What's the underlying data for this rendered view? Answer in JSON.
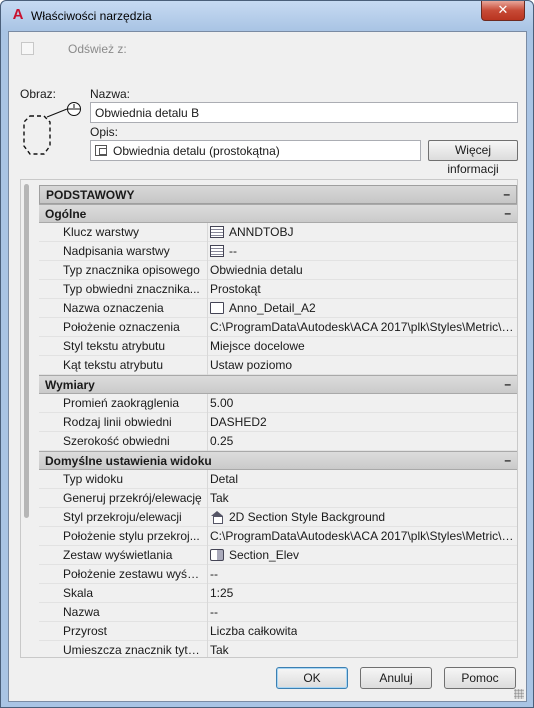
{
  "window": {
    "title": "Właściwości narzędzia",
    "close_glyph": "✕",
    "app_icon": "autocad-a-icon"
  },
  "refresh": {
    "label": "Odśwież z:",
    "checked": false,
    "enabled": false
  },
  "image": {
    "label": "Obraz:"
  },
  "name": {
    "label": "Nazwa:",
    "value": "Obwiednia detalu B"
  },
  "description": {
    "label": "Opis:",
    "value": "Obwiednia detalu (prostokątna)",
    "more_button": "Więcej informacji"
  },
  "grid": {
    "top_category": {
      "label": "PODSTAWOWY",
      "toggle": "–"
    },
    "sections": [
      {
        "label": "Ogólne",
        "toggle": "–",
        "rows": [
          {
            "name": "Klucz warstwy",
            "value": "ANNDTOBJ",
            "icon": "layer-icon"
          },
          {
            "name": "Nadpisania warstwy",
            "value": "--",
            "icon": "layer-icon"
          },
          {
            "name": "Typ znacznika opisowego",
            "value": "Obwiednia detalu",
            "icon": ""
          },
          {
            "name": "Typ obwiedni znacznika...",
            "value": "Prostokąt",
            "icon": ""
          },
          {
            "name": "Nazwa oznaczenia",
            "value": "Anno_Detail_A2",
            "icon": "block-icon"
          },
          {
            "name": "Położenie oznaczenia",
            "value": "C:\\ProgramData\\Autodesk\\ACA 2017\\plk\\Styles\\Metric\\Callo...",
            "icon": ""
          },
          {
            "name": "Styl tekstu atrybutu",
            "value": "Miejsce docelowe",
            "icon": ""
          },
          {
            "name": "Kąt tekstu atrybutu",
            "value": "Ustaw poziomo",
            "icon": ""
          }
        ]
      },
      {
        "label": "Wymiary",
        "toggle": "–",
        "rows": [
          {
            "name": "Promień zaokrąglenia",
            "value": "5.00",
            "icon": ""
          },
          {
            "name": "Rodzaj linii obwiedni",
            "value": "DASHED2",
            "icon": ""
          },
          {
            "name": "Szerokość obwiedni",
            "value": "0.25",
            "icon": ""
          }
        ]
      },
      {
        "label": "Domyślne ustawienia widoku",
        "toggle": "–",
        "rows": [
          {
            "name": "Typ widoku",
            "value": "Detal",
            "icon": ""
          },
          {
            "name": "Generuj przekrój/elewację",
            "value": "Tak",
            "icon": ""
          },
          {
            "name": "Styl przekroju/elewacji",
            "value": "2D Section Style Background",
            "icon": "style-icon"
          },
          {
            "name": "Położenie stylu przekroj...",
            "value": "C:\\ProgramData\\Autodesk\\ACA 2017\\plk\\Styles\\Metric\\Secti...",
            "icon": ""
          },
          {
            "name": "Zestaw wyświetlania",
            "value": "Section_Elev",
            "icon": "display-set-icon"
          },
          {
            "name": "Położenie zestawu wyśw...",
            "value": "--",
            "icon": ""
          },
          {
            "name": "Skala",
            "value": "1:25",
            "icon": ""
          },
          {
            "name": "Nazwa",
            "value": "--",
            "icon": ""
          },
          {
            "name": "Przyrost",
            "value": "Liczba całkowita",
            "icon": ""
          },
          {
            "name": "Umieszcza znacznik tytułu",
            "value": "Tak",
            "icon": ""
          }
        ]
      }
    ]
  },
  "buttons": {
    "ok": "OK",
    "cancel": "Anuluj",
    "help": "Pomoc"
  }
}
